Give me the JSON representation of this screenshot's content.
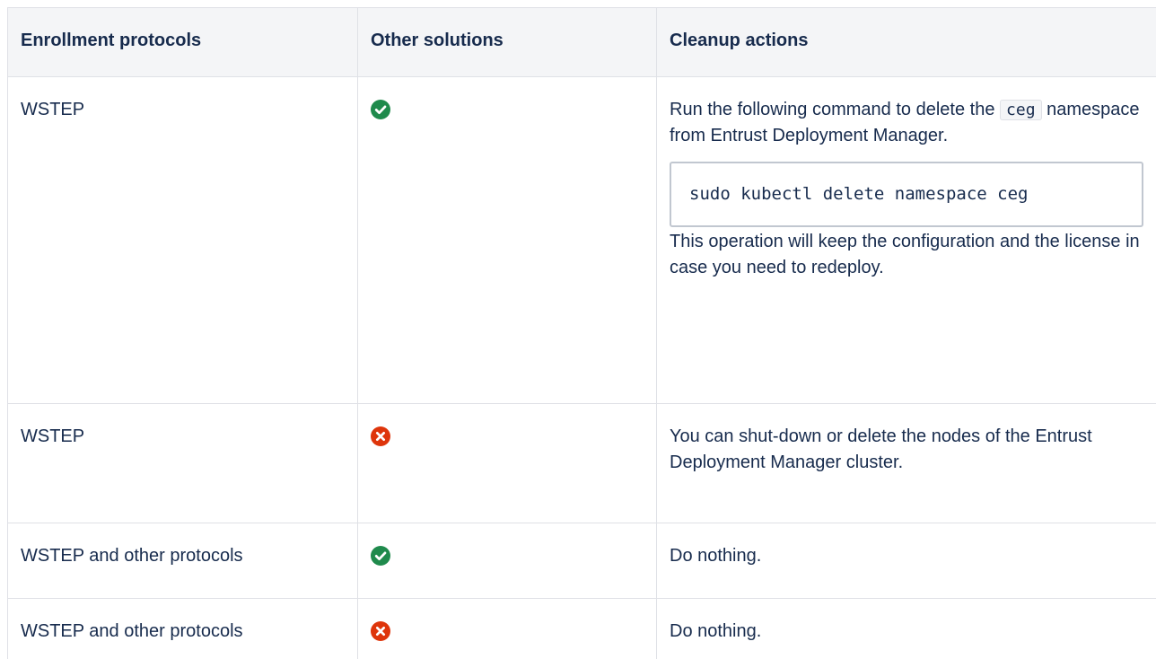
{
  "table": {
    "headers": [
      "Enrollment protocols",
      "Other solutions",
      "Cleanup actions"
    ],
    "rows": [
      {
        "protocol": "WSTEP",
        "other_solutions": "yes",
        "cleanup": {
          "before_code": "Run the following command to delete the",
          "inline_code": "ceg",
          "after_inline": "namespace from Entrust Deployment Manager.",
          "code_block": "sudo kubectl delete namespace ceg",
          "after_code": "This operation will keep the configuration and the license in case you need to redeploy."
        }
      },
      {
        "protocol": "WSTEP",
        "other_solutions": "no",
        "cleanup": {
          "text": "You can shut-down or delete the nodes of the Entrust Deployment Manager cluster."
        }
      },
      {
        "protocol": "WSTEP and other protocols",
        "other_solutions": "yes",
        "cleanup": {
          "text": "Do nothing."
        }
      },
      {
        "protocol": "WSTEP and other protocols",
        "other_solutions": "no",
        "cleanup": {
          "text": "Do nothing."
        }
      }
    ]
  },
  "icons": {
    "yes": "check-circle-icon",
    "no": "error-circle-icon"
  },
  "colors": {
    "check": "#1f8a4c",
    "error": "#de350b",
    "header_bg": "#f4f5f7",
    "border": "#dfe1e6"
  }
}
